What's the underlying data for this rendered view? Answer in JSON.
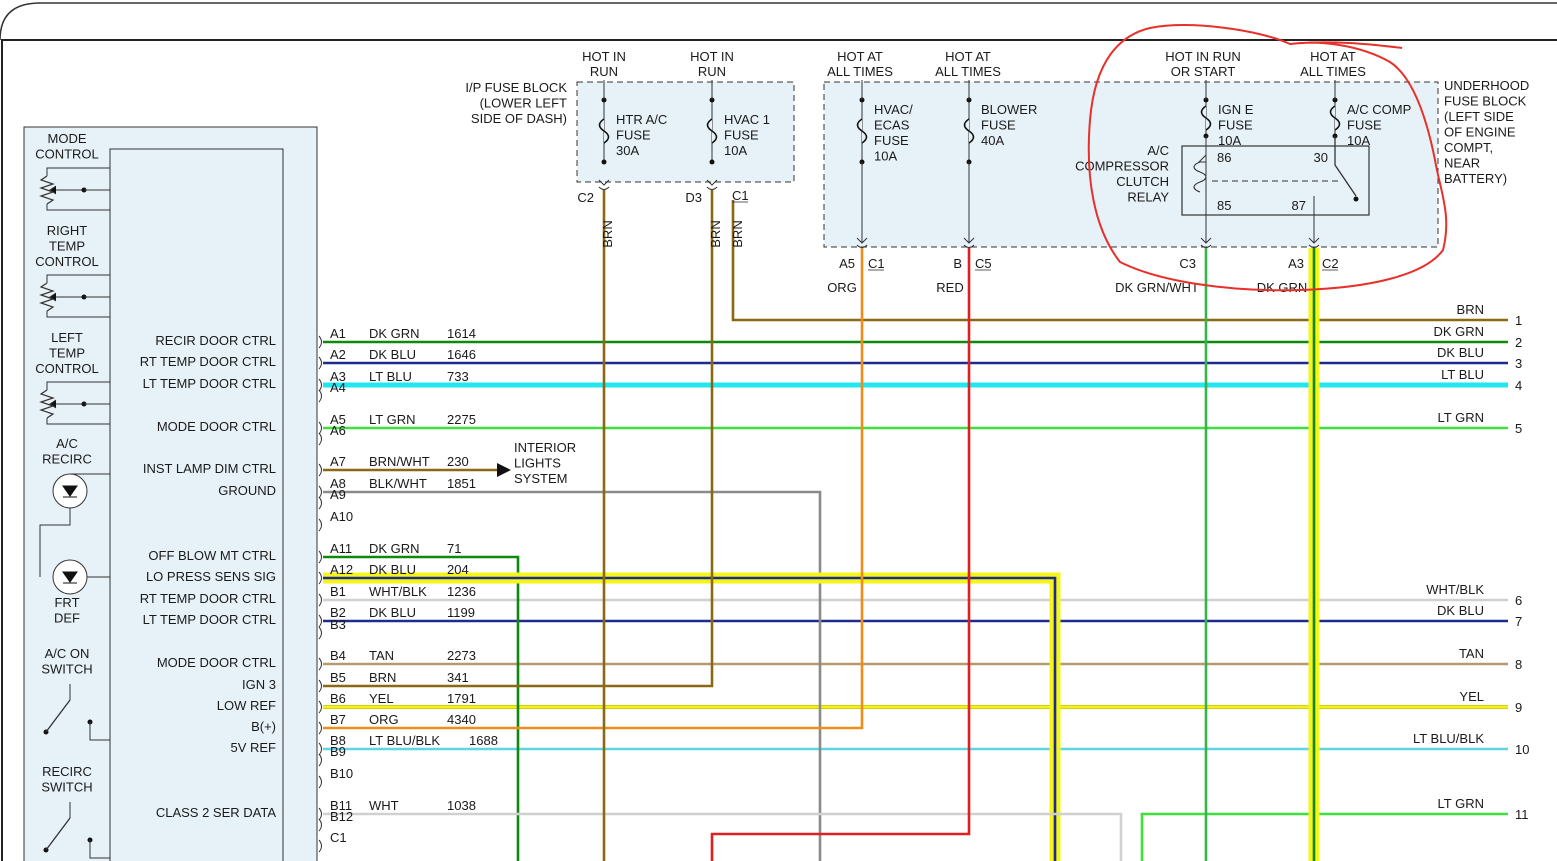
{
  "control_module": {
    "controls": [
      {
        "name": "mode-control",
        "lines": [
          "MODE",
          "CONTROL"
        ]
      },
      {
        "name": "right-temp-control",
        "lines": [
          "RIGHT",
          "TEMP",
          "CONTROL"
        ]
      },
      {
        "name": "left-temp-control",
        "lines": [
          "LEFT",
          "TEMP",
          "CONTROL"
        ]
      },
      {
        "name": "ac-recirc-indicator",
        "lines": [
          "A/C",
          "RECIRC"
        ]
      },
      {
        "name": "frt-def-indicator",
        "lines": [
          "FRT",
          "DEF"
        ]
      },
      {
        "name": "ac-on-switch",
        "lines": [
          "A/C ON",
          "SWITCH"
        ]
      },
      {
        "name": "recirc-switch",
        "lines": [
          "RECIRC",
          "SWITCH"
        ]
      }
    ]
  },
  "pins": [
    {
      "pin": "A1",
      "func": "RECIR DOOR CTRL",
      "color": "DK GRN",
      "circuit": "1614"
    },
    {
      "pin": "A2",
      "func": "RT TEMP DOOR CTRL",
      "color": "DK BLU",
      "circuit": "1646"
    },
    {
      "pin": "A3",
      "func": "LT TEMP DOOR CTRL",
      "color": "LT BLU",
      "circuit": "733"
    },
    {
      "pin": "A4",
      "func": "",
      "color": "",
      "circuit": ""
    },
    {
      "pin": "A5",
      "func": "MODE DOOR CTRL",
      "color": "LT GRN",
      "circuit": "2275"
    },
    {
      "pin": "A6",
      "func": "",
      "color": "",
      "circuit": ""
    },
    {
      "pin": "A7",
      "func": "INST LAMP DIM CTRL",
      "color": "BRN/WHT",
      "circuit": "230"
    },
    {
      "pin": "A8",
      "func": "GROUND",
      "color": "BLK/WHT",
      "circuit": "1851"
    },
    {
      "pin": "A9",
      "func": "",
      "color": "",
      "circuit": ""
    },
    {
      "pin": "A10",
      "func": "",
      "color": "",
      "circuit": ""
    },
    {
      "pin": "A11",
      "func": "OFF BLOW MT CTRL",
      "color": "DK GRN",
      "circuit": "71"
    },
    {
      "pin": "A12",
      "func": "LO PRESS SENS SIG",
      "color": "DK BLU",
      "circuit": "204"
    },
    {
      "pin": "B1",
      "func": "RT TEMP DOOR CTRL",
      "color": "WHT/BLK",
      "circuit": "1236"
    },
    {
      "pin": "B2",
      "func": "LT TEMP DOOR CTRL",
      "color": "DK BLU",
      "circuit": "1199"
    },
    {
      "pin": "B3",
      "func": "",
      "color": "",
      "circuit": ""
    },
    {
      "pin": "B4",
      "func": "MODE DOOR CTRL",
      "color": "TAN",
      "circuit": "2273"
    },
    {
      "pin": "B5",
      "func": "IGN 3",
      "color": "BRN",
      "circuit": "341"
    },
    {
      "pin": "B6",
      "func": "LOW REF",
      "color": "YEL",
      "circuit": "1791"
    },
    {
      "pin": "B7",
      "func": "B(+)",
      "color": "ORG",
      "circuit": "4340"
    },
    {
      "pin": "B8",
      "func": "5V REF",
      "color": "LT BLU/BLK",
      "circuit": "1688"
    },
    {
      "pin": "B9",
      "func": "",
      "color": "",
      "circuit": ""
    },
    {
      "pin": "B10",
      "func": "",
      "color": "",
      "circuit": ""
    },
    {
      "pin": "B11",
      "func": "CLASS 2 SER DATA",
      "color": "WHT",
      "circuit": "1038"
    },
    {
      "pin": "B12",
      "func": "",
      "color": "",
      "circuit": ""
    },
    {
      "pin": "C1",
      "func": "",
      "color": "",
      "circuit": ""
    }
  ],
  "interior_lights": [
    "INTERIOR",
    "LIGHTS",
    "SYSTEM"
  ],
  "ip_fuse_block": {
    "title": [
      "I/P FUSE BLOCK",
      "(LOWER LEFT",
      "SIDE OF DASH)"
    ],
    "fuses": [
      {
        "hot": [
          "HOT IN",
          "RUN"
        ],
        "name": [
          "HTR A/C",
          "FUSE",
          "30A"
        ],
        "pin": "C2",
        "conn": "",
        "wire": "BRN"
      },
      {
        "hot": [
          "HOT IN",
          "RUN"
        ],
        "name": [
          "HVAC 1",
          "FUSE",
          "10A"
        ],
        "pin": "D3",
        "conn": "C1",
        "wire": "BRN",
        "wire2": "BRN"
      }
    ]
  },
  "underhood_fuse_block": {
    "title": [
      "UNDERHOOD",
      "FUSE BLOCK",
      "(LEFT SIDE",
      "OF ENGINE",
      "COMPT,",
      "NEAR",
      "BATTERY)"
    ],
    "fuses": [
      {
        "hot": [
          "HOT AT",
          "ALL TIMES"
        ],
        "name": [
          "HVAC/",
          "ECAS",
          "FUSE",
          "10A"
        ],
        "pin": "A5",
        "conn": "C1",
        "wire": "ORG"
      },
      {
        "hot": [
          "HOT AT",
          "ALL TIMES"
        ],
        "name": [
          "BLOWER",
          "FUSE",
          "40A"
        ],
        "pin": "B",
        "conn": "C5",
        "wire": "RED"
      },
      {
        "hot": [
          "HOT IN RUN",
          "OR START"
        ],
        "name": [
          "IGN E",
          "FUSE",
          "10A"
        ],
        "pin": "C3",
        "conn": "",
        "wire": "DK GRN/WHT"
      },
      {
        "hot": [
          "HOT AT",
          "ALL TIMES"
        ],
        "name": [
          "A/C COMP",
          "FUSE",
          "10A"
        ],
        "pin": "A3",
        "conn": "C2",
        "wire": "DK GRN"
      }
    ],
    "relay": {
      "name": [
        "A/C",
        "COMPRESSOR",
        "CLUTCH",
        "RELAY"
      ],
      "terminals": [
        "86",
        "30",
        "85",
        "87"
      ]
    }
  },
  "right_wires": [
    {
      "num": "1",
      "label": "BRN",
      "color": "#8b6914"
    },
    {
      "num": "2",
      "label": "DK GRN",
      "color": "#0d8a0d"
    },
    {
      "num": "3",
      "label": "DK BLU",
      "color": "#1c2b8c"
    },
    {
      "num": "4",
      "label": "LT BLU",
      "color": "#22e6f0"
    },
    {
      "num": "5",
      "label": "LT GRN",
      "color": "#3ee03e"
    },
    {
      "num": "6",
      "label": "WHT/BLK",
      "color": "#b8b8b8"
    },
    {
      "num": "7",
      "label": "DK BLU",
      "color": "#1c2b8c"
    },
    {
      "num": "8",
      "label": "TAN",
      "color": "#b39b6e"
    },
    {
      "num": "9",
      "label": "YEL",
      "color": "#f2f21a"
    },
    {
      "num": "10",
      "label": "LT BLU/BLK",
      "color": "#5fd6e0"
    },
    {
      "num": "11",
      "label": "LT GRN",
      "color": "#3ee03e"
    }
  ],
  "colors": {
    "brn": "#8b6914",
    "dk_grn": "#0d8a0d",
    "dk_blu": "#1c2b8c",
    "lt_blu": "#22e6f0",
    "lt_grn": "#3ee03e",
    "org": "#f08c1a",
    "red": "#e02020",
    "yel": "#f2f21a",
    "wht": "#d0d0d0",
    "gray": "#8a8a8a",
    "tan": "#b39b6e",
    "highlight": "#f5f51a",
    "annotation": "#e8302a",
    "fuse_box_fill": "#e7f2f8"
  }
}
